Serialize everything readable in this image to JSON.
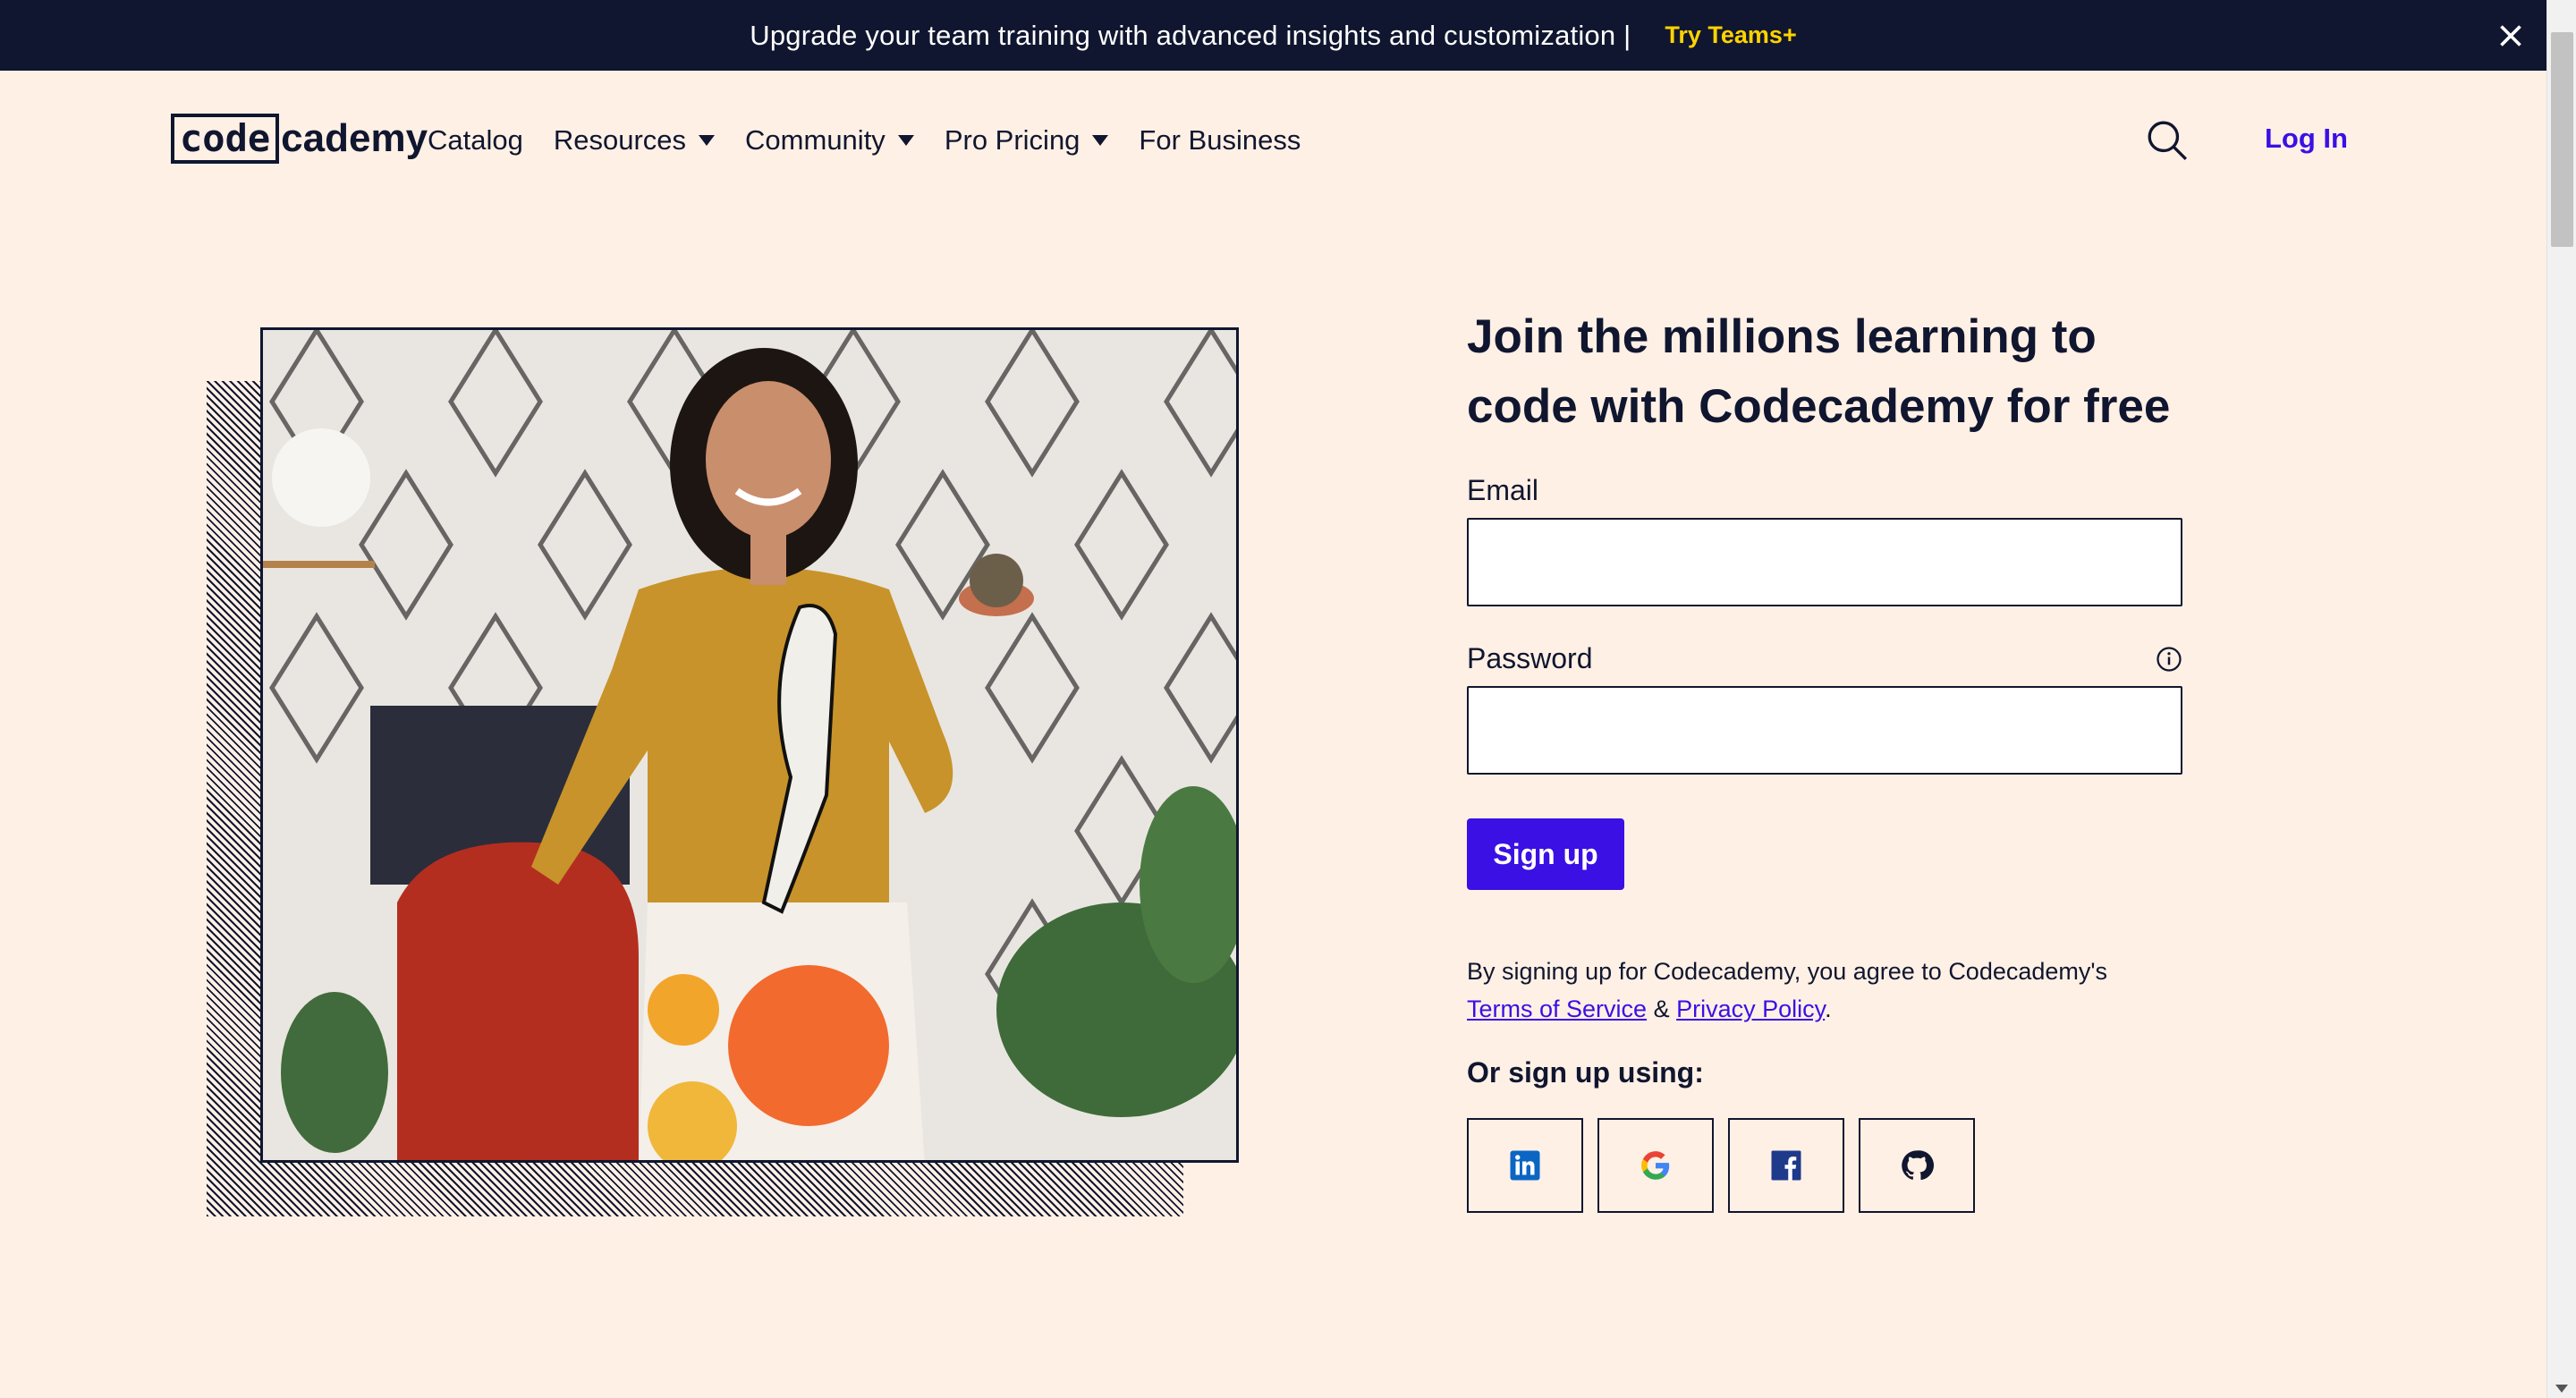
{
  "banner": {
    "text": "Upgrade your team training with advanced insights and customization |",
    "cta": "Try Teams+",
    "cta_color": "#ffd300",
    "close_icon": "close-icon"
  },
  "nav": {
    "logo_code": "code",
    "logo_cademy": "cademy",
    "items": [
      {
        "label": "Catalog",
        "has_dropdown": false
      },
      {
        "label": "Resources",
        "has_dropdown": true
      },
      {
        "label": "Community",
        "has_dropdown": true
      },
      {
        "label": "Pro Pricing",
        "has_dropdown": true
      },
      {
        "label": "For Business",
        "has_dropdown": false
      }
    ],
    "search_icon": "search-icon",
    "login": "Log In"
  },
  "form": {
    "headline": "Join the millions learning to code with Codecademy for free",
    "email_label": "Email",
    "email_value": "",
    "password_label": "Password",
    "password_value": "",
    "info_icon": "info-icon",
    "signup_button": "Sign up",
    "legal_prefix": "By signing up for Codecademy, you agree to Codecademy's",
    "terms_link": "Terms of Service",
    "ampersand": "&",
    "privacy_link": "Privacy Policy",
    "period": ".",
    "or_label": "Or sign up using:",
    "social": [
      "linkedin-icon",
      "google-icon",
      "facebook-icon",
      "github-icon"
    ]
  },
  "colors": {
    "background": "#fff0e5",
    "navy": "#10162f",
    "accent": "#3a10e5"
  }
}
